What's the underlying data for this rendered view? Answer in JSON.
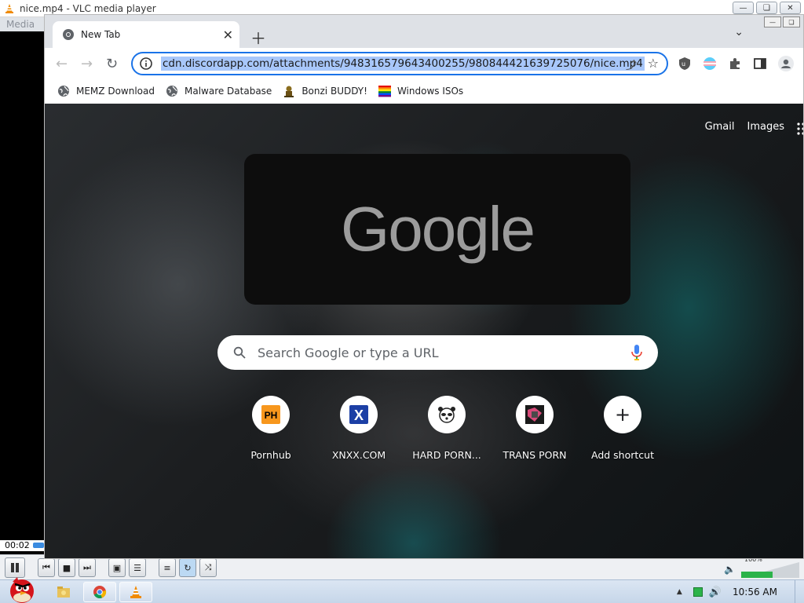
{
  "vlc": {
    "title": "nice.mp4 - VLC media player",
    "menu_label": "Media",
    "elapsed_time": "00:02",
    "volume_percent": "100%",
    "volume_level": 1.0
  },
  "chrome": {
    "tab": {
      "title": "New Tab"
    },
    "omnibox": {
      "url": "cdn.discordapp.com/attachments/948316579643400255/980844421639725076/nice.mp4"
    },
    "bookmarks": [
      {
        "label": "MEMZ Download",
        "icon": "globe-icon"
      },
      {
        "label": "Malware Database",
        "icon": "globe-icon"
      },
      {
        "label": "Bonzi BUDDY!",
        "icon": "bonzi-icon"
      },
      {
        "label": "Windows ISOs",
        "icon": "windows-flag-icon"
      }
    ],
    "ntp": {
      "links": [
        "Gmail",
        "Images"
      ],
      "logo_text": "Google",
      "search_placeholder": "Search Google or type a URL",
      "shortcuts": [
        {
          "label": "Pornhub",
          "icon_text": "PH"
        },
        {
          "label": "XNXX.COM",
          "icon_text": "X"
        },
        {
          "label": "HARD PORN...",
          "icon_text": ""
        },
        {
          "label": "TRANS PORN",
          "icon_text": ""
        },
        {
          "label": "Add shortcut",
          "icon_text": "+"
        }
      ]
    }
  },
  "taskbar": {
    "clock": "10:56 AM"
  },
  "colors": {
    "omnibox_focus": "#1a73e8",
    "url_selection": "#a8c7fa",
    "vlc_cone": "#f08a00",
    "ph_orange": "#f7971d",
    "xnxx_blue": "#1c3fa5"
  }
}
